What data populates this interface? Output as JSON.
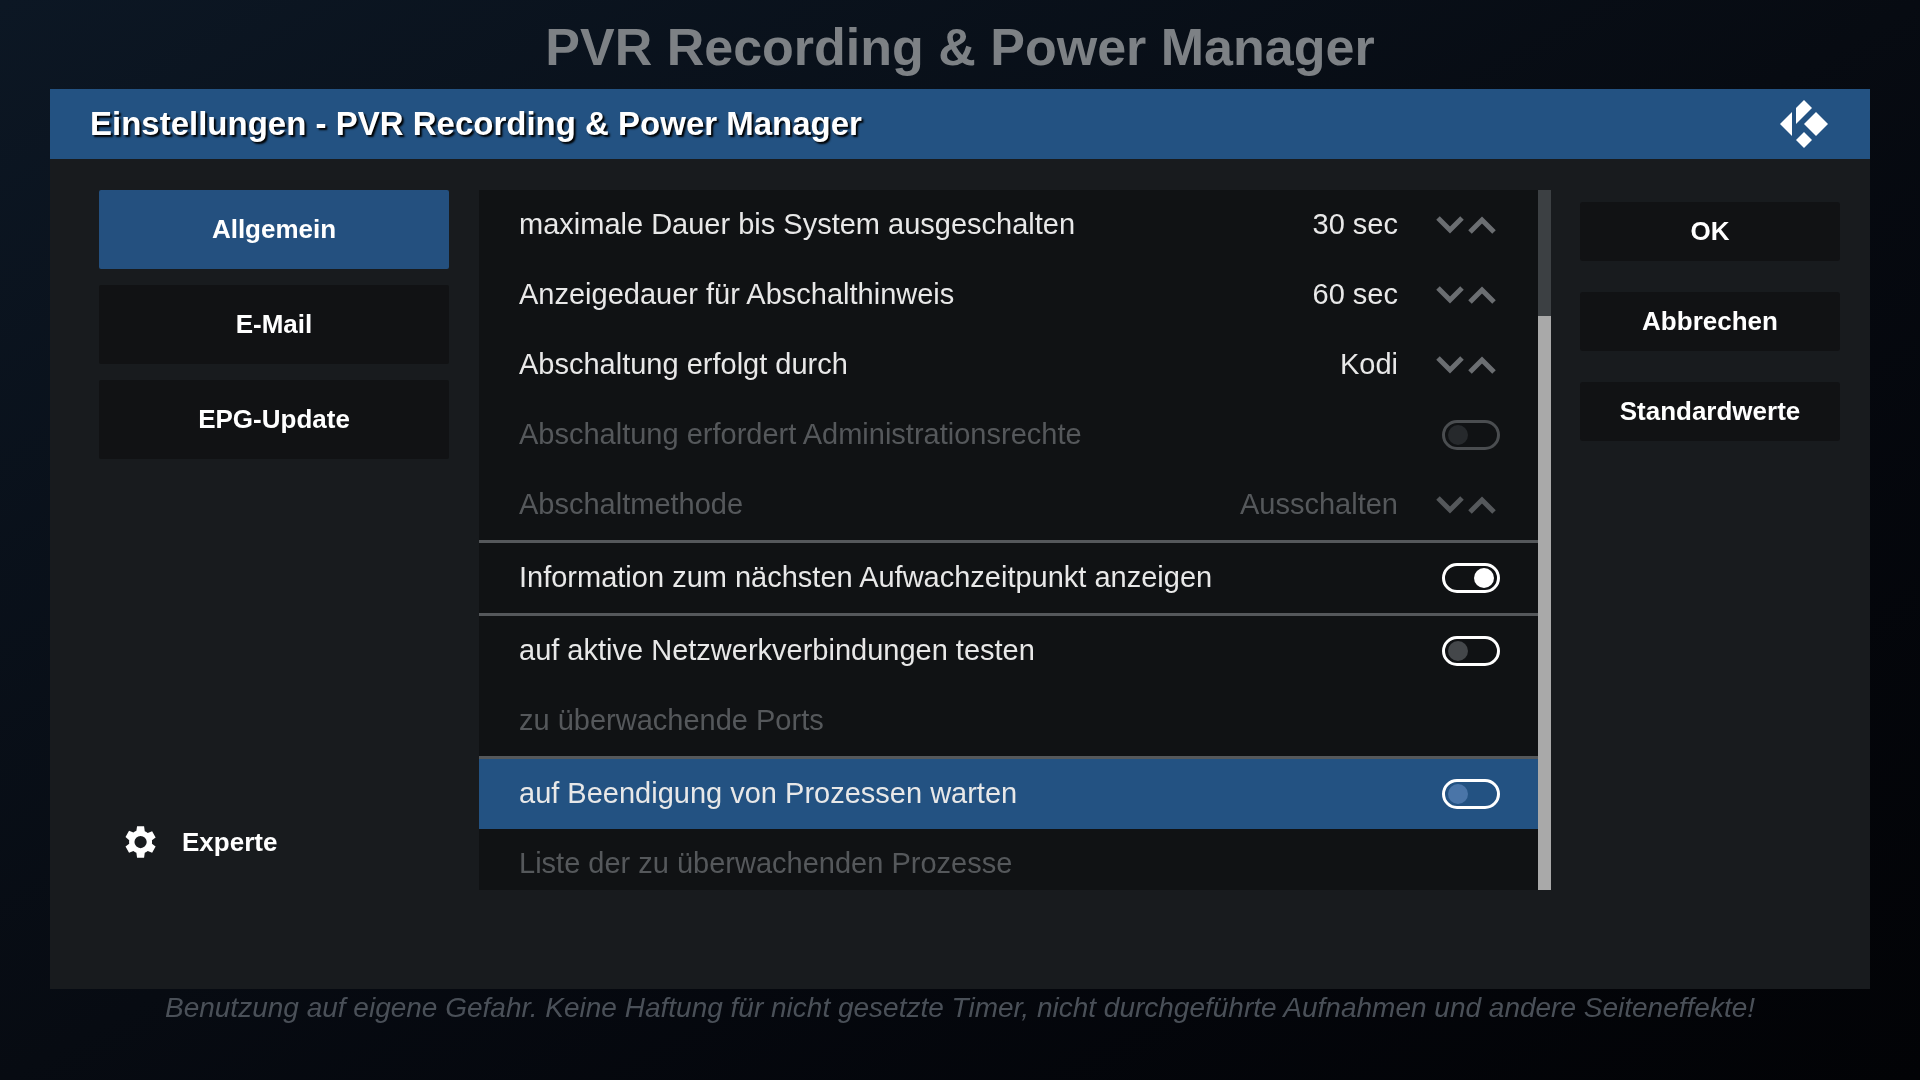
{
  "page_title": "PVR Recording & Power Manager",
  "dialog": {
    "title": "Einstellungen - PVR Recording & Power Manager"
  },
  "categories": [
    {
      "label": "Allgemein",
      "selected": true
    },
    {
      "label": "E-Mail",
      "selected": false
    },
    {
      "label": "EPG-Update",
      "selected": false
    }
  ],
  "level_button": {
    "label": "Experte"
  },
  "sections": [
    {
      "rows": [
        {
          "kind": "spinner",
          "label": "maximale Dauer bis System ausgeschalten",
          "value": "30 sec",
          "disabled": false,
          "selected": false
        },
        {
          "kind": "spinner",
          "label": "Anzeigedauer für Abschalthinweis",
          "value": "60 sec",
          "disabled": false,
          "selected": false
        },
        {
          "kind": "spinner",
          "label": "Abschaltung erfolgt durch",
          "value": "Kodi",
          "disabled": false,
          "selected": false
        },
        {
          "kind": "toggle",
          "label": "Abschaltung erfordert Administrationsrechte",
          "on": false,
          "disabled": true,
          "selected": false
        },
        {
          "kind": "spinner",
          "label": "Abschaltmethode",
          "value": "Ausschalten",
          "disabled": true,
          "selected": false
        }
      ]
    },
    {
      "rows": [
        {
          "kind": "toggle",
          "label": "Information zum nächsten Aufwachzeitpunkt anzeigen",
          "on": true,
          "disabled": false,
          "selected": false
        }
      ]
    },
    {
      "rows": [
        {
          "kind": "toggle",
          "label": "auf aktive Netzwerkverbindungen testen",
          "on": false,
          "disabled": false,
          "selected": false
        },
        {
          "kind": "text",
          "label": "zu überwachende Ports",
          "disabled": true,
          "selected": false
        }
      ]
    },
    {
      "rows": [
        {
          "kind": "toggle",
          "label": "auf Beendigung von Prozessen warten",
          "on": false,
          "disabled": false,
          "selected": true
        },
        {
          "kind": "text",
          "label": "Liste der zu überwachenden Prozesse",
          "disabled": true,
          "selected": false
        }
      ]
    }
  ],
  "buttons": [
    "OK",
    "Abbrechen",
    "Standardwerte"
  ],
  "footer": "Benutzung auf eigene Gefahr. Keine Haftung für nicht gesetzte Timer, nicht durchgeführte Aufnahmen und andere Seiteneffekte!"
}
